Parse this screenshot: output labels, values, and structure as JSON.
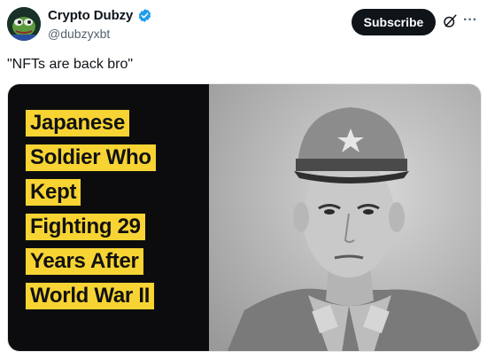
{
  "author": {
    "display_name": "Crypto Dubzy",
    "handle": "@dubzyxbt",
    "verified_color": "#1d9bf0"
  },
  "actions": {
    "subscribe_label": "Subscribe",
    "grok_icon": "grok-icon",
    "more_icon": "more-icon",
    "more_glyph": "···"
  },
  "tweet": {
    "text": "\"NFTs are back bro\""
  },
  "media": {
    "caption_lines": [
      "Japanese",
      "Soldier Who",
      "Kept",
      "Fighting 29",
      "Years After",
      "World War II"
    ],
    "caption_bg": "#f7d433",
    "panel_bg": "#0c0c0e"
  }
}
